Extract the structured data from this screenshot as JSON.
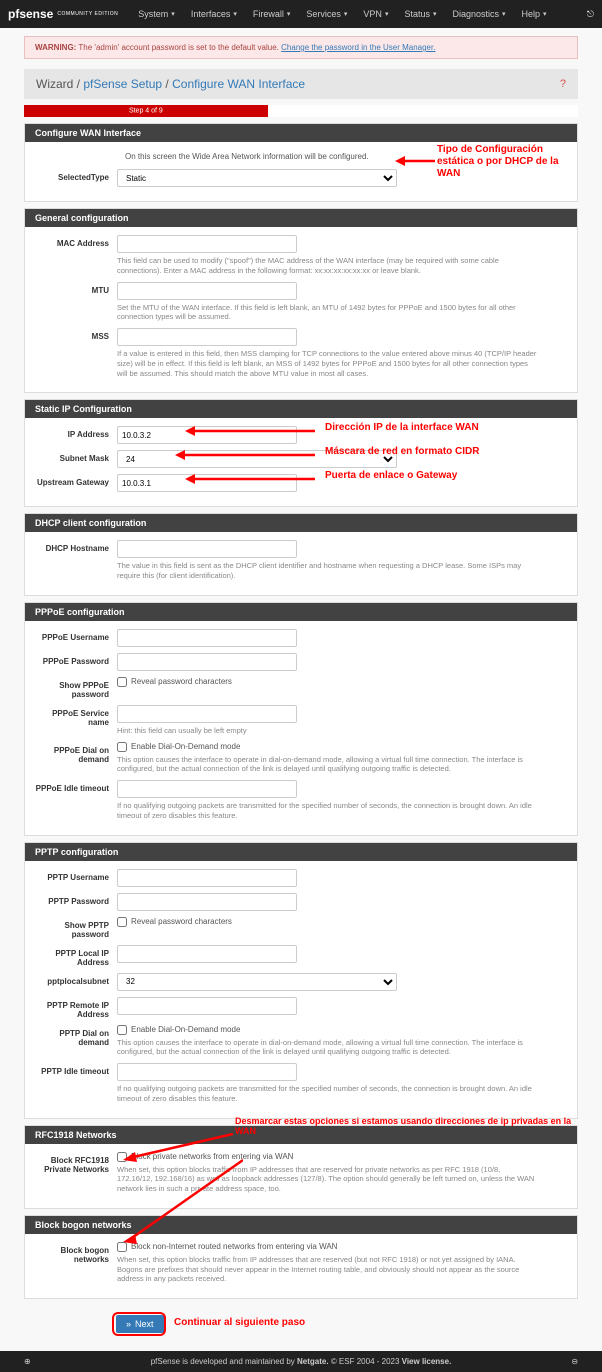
{
  "navbar": {
    "logo": "pfsense",
    "logo_sub": "COMMUNITY EDITION",
    "items": [
      "System",
      "Interfaces",
      "Firewall",
      "Services",
      "VPN",
      "Status",
      "Diagnostics",
      "Help"
    ]
  },
  "warning": {
    "label": "WARNING:",
    "text": "The 'admin' account password is set to the default value.",
    "link": "Change the password in the User Manager."
  },
  "breadcrumb": {
    "wizard": "Wizard",
    "setup": "pfSense Setup",
    "page": "Configure WAN Interface"
  },
  "progress": {
    "step_text": "Step 4 of 9",
    "percent": 44
  },
  "sections": {
    "configure_wan": {
      "title": "Configure WAN Interface",
      "info": "On this screen the Wide Area Network information will be configured.",
      "selected_type_label": "SelectedType",
      "selected_type_value": "Static"
    },
    "general": {
      "title": "General configuration",
      "mac_label": "MAC Address",
      "mac_help": "This field can be used to modify (\"spoof\") the MAC address of the WAN interface (may be required with some cable connections). Enter a MAC address in the following format: xx:xx:xx:xx:xx:xx or leave blank.",
      "mtu_label": "MTU",
      "mtu_help": "Set the MTU of the WAN interface. If this field is left blank, an MTU of 1492 bytes for PPPoE and 1500 bytes for all other connection types will be assumed.",
      "mss_label": "MSS",
      "mss_help": "If a value is entered in this field, then MSS clamping for TCP connections to the value entered above minus 40 (TCP/IP header size) will be in effect. If this field is left blank, an MSS of 1492 bytes for PPPoE and 1500 bytes for all other connection types will be assumed. This should match the above MTU value in most all cases."
    },
    "static_ip": {
      "title": "Static IP Configuration",
      "ip_label": "IP Address",
      "ip_value": "10.0.3.2",
      "subnet_label": "Subnet Mask",
      "subnet_value": "24",
      "gateway_label": "Upstream Gateway",
      "gateway_value": "10.0.3.1"
    },
    "dhcp": {
      "title": "DHCP client configuration",
      "hostname_label": "DHCP Hostname",
      "hostname_help": "The value in this field is sent as the DHCP client identifier and hostname when requesting a DHCP lease. Some ISPs may require this (for client identification)."
    },
    "pppoe": {
      "title": "PPPoE configuration",
      "username_label": "PPPoE Username",
      "password_label": "PPPoE Password",
      "show_pw_label": "Show PPPoE password",
      "show_pw_cb": "Reveal password characters",
      "service_label": "PPPoE Service name",
      "service_help": "Hint: this field can usually be left empty",
      "dial_label": "PPPoE Dial on demand",
      "dial_cb": "Enable Dial-On-Demand mode",
      "dial_help": "This option causes the interface to operate in dial-on-demand mode, allowing a virtual full time connection. The interface is configured, but the actual connection of the link is delayed until qualifying outgoing traffic is detected.",
      "idle_label": "PPPoE Idle timeout",
      "idle_help": "If no qualifying outgoing packets are transmitted for the specified number of seconds, the connection is brought down. An idle timeout of zero disables this feature."
    },
    "pptp": {
      "title": "PPTP configuration",
      "username_label": "PPTP Username",
      "password_label": "PPTP Password",
      "show_pw_label": "Show PPTP password",
      "show_pw_cb": "Reveal password characters",
      "local_ip_label": "PPTP Local IP Address",
      "subnet_label": "pptplocalsubnet",
      "subnet_value": "32",
      "remote_ip_label": "PPTP Remote IP Address",
      "dial_label": "PPTP Dial on demand",
      "dial_cb": "Enable Dial-On-Demand mode",
      "dial_help": "This option causes the interface to operate in dial-on-demand mode, allowing a virtual full time connection. The interface is configured, but the actual connection of the link is delayed until qualifying outgoing traffic is detected.",
      "idle_label": "PPTP Idle timeout",
      "idle_help": "If no qualifying outgoing packets are transmitted for the specified number of seconds, the connection is brought down. An idle timeout of zero disables this feature."
    },
    "rfc1918": {
      "title": "RFC1918 Networks",
      "block_label": "Block RFC1918 Private Networks",
      "block_cb": "Block private networks from entering via WAN",
      "block_help": "When set, this option blocks traffic from IP addresses that are reserved for private networks as per RFC 1918 (10/8, 172.16/12, 192.168/16) as well as loopback addresses (127/8). The option should generally be left turned on, unless the WAN network lies in such a private address space, too."
    },
    "bogon": {
      "title": "Block bogon networks",
      "block_label": "Block bogon networks",
      "block_cb": "Block non-Internet routed networks from entering via WAN",
      "block_help": "When set, this option blocks traffic from IP addresses that are reserved (but not RFC 1918) or not yet assigned by IANA. Bogons are prefixes that should never appear in the Internet routing table, and obviously should not appear as the source address in any packets received."
    }
  },
  "annotations": {
    "wan_type": "Tipo de Configuración estática o por DHCP de la WAN",
    "ip": "Dirección IP de la interface WAN",
    "subnet": "Máscara de red en formato CIDR",
    "gateway": "Puerta de enlace o Gateway",
    "rfc1918": "Desmarcar estas opciones si estamos usando direcciones de ip privadas en la WAN",
    "next": "Continuar al siguiente paso"
  },
  "next_button": "Next",
  "footer": {
    "text1": "pfSense is developed and maintained by ",
    "netgate": "Netgate.",
    "text2": " © ESF 2004 - 2023 ",
    "view": "View license."
  }
}
